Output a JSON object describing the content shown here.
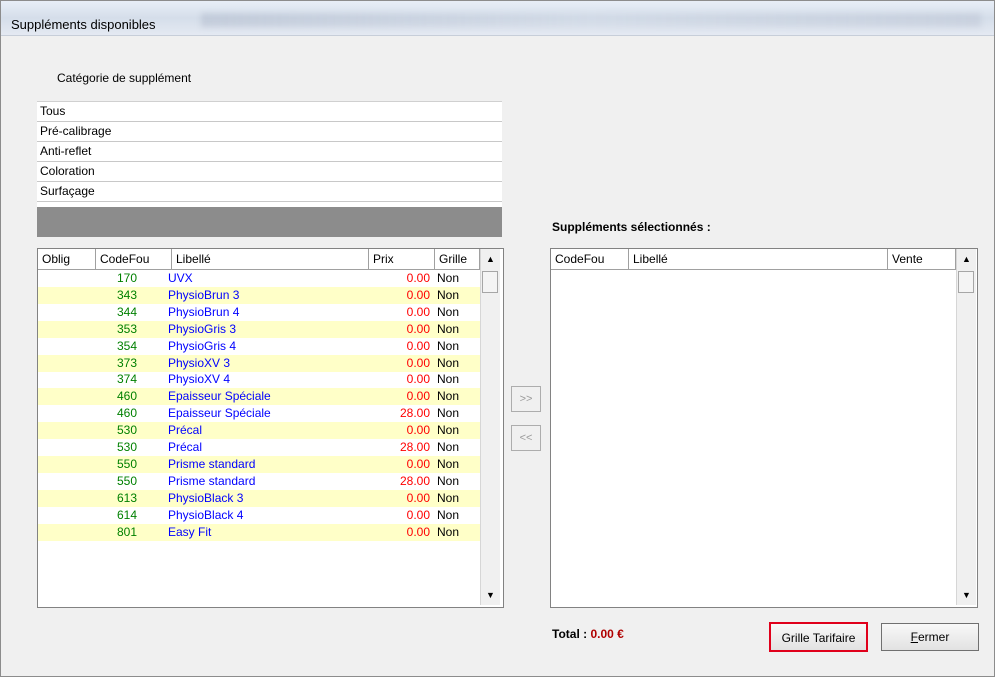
{
  "window": {
    "title": "Suppléments disponibles"
  },
  "category": {
    "label": "Catégorie de supplément",
    "items": [
      "Tous",
      "Pré-calibrage",
      "Anti-reflet",
      "Coloration",
      "Surfaçage"
    ]
  },
  "available": {
    "columns": [
      "Oblig",
      "CodeFou",
      "Libellé",
      "Prix",
      "Grille"
    ],
    "rows": [
      {
        "code": "170",
        "libelle": "UVX",
        "prix": "0.00",
        "grille": "Non"
      },
      {
        "code": "343",
        "libelle": "PhysioBrun 3",
        "prix": "0.00",
        "grille": "Non"
      },
      {
        "code": "344",
        "libelle": "PhysioBrun 4",
        "prix": "0.00",
        "grille": "Non"
      },
      {
        "code": "353",
        "libelle": "PhysioGris 3",
        "prix": "0.00",
        "grille": "Non"
      },
      {
        "code": "354",
        "libelle": "PhysioGris 4",
        "prix": "0.00",
        "grille": "Non"
      },
      {
        "code": "373",
        "libelle": "PhysioXV 3",
        "prix": "0.00",
        "grille": "Non"
      },
      {
        "code": "374",
        "libelle": "PhysioXV 4",
        "prix": "0.00",
        "grille": "Non"
      },
      {
        "code": "460",
        "libelle": "Epaisseur Spéciale",
        "prix": "0.00",
        "grille": "Non"
      },
      {
        "code": "460",
        "libelle": "Epaisseur Spéciale",
        "prix": "28.00",
        "grille": "Non"
      },
      {
        "code": "530",
        "libelle": "Précal",
        "prix": "0.00",
        "grille": "Non"
      },
      {
        "code": "530",
        "libelle": "Précal",
        "prix": "28.00",
        "grille": "Non"
      },
      {
        "code": "550",
        "libelle": "Prisme standard",
        "prix": "0.00",
        "grille": "Non"
      },
      {
        "code": "550",
        "libelle": "Prisme standard",
        "prix": "28.00",
        "grille": "Non"
      },
      {
        "code": "613",
        "libelle": "PhysioBlack 3",
        "prix": "0.00",
        "grille": "Non"
      },
      {
        "code": "614",
        "libelle": "PhysioBlack 4",
        "prix": "0.00",
        "grille": "Non"
      },
      {
        "code": "801",
        "libelle": "Easy Fit",
        "prix": "0.00",
        "grille": "Non"
      }
    ]
  },
  "transfer": {
    "add_label": ">>",
    "remove_label": "<<"
  },
  "selected": {
    "title": "Suppléments sélectionnés :",
    "columns": [
      "CodeFou",
      "Libellé",
      "Vente"
    ]
  },
  "total": {
    "label": "Total :",
    "value": "0.00 €"
  },
  "buttons": {
    "grille_tarifaire": "Grille Tarifaire",
    "fermer_mnemonic": "F",
    "fermer_rest": "ermer"
  },
  "colors": {
    "code": "#008000",
    "libelle": "#0000ff",
    "prix": "#ff0000",
    "row_alt": "#ffffc8",
    "highlight_border": "#e0001b"
  },
  "icons": {
    "scroll_up": "▲",
    "scroll_down": "▼"
  }
}
